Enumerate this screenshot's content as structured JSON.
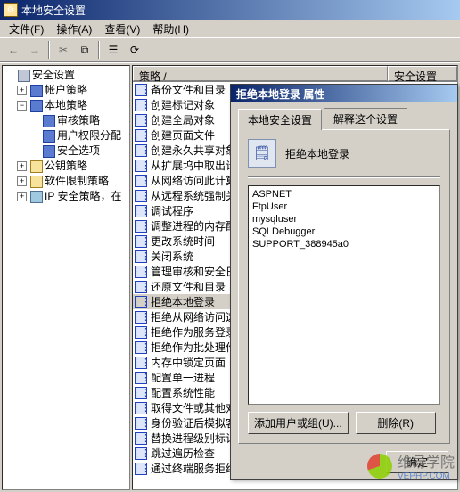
{
  "window": {
    "title": "本地安全设置"
  },
  "menu": {
    "file": "文件(F)",
    "action": "操作(A)",
    "view": "查看(V)",
    "help": "帮助(H)"
  },
  "tree": {
    "root": "安全设置",
    "account_policy": "帐户策略",
    "local_policy": "本地策略",
    "audit_policy": "审核策略",
    "user_rights": "用户权限分配",
    "security_options": "安全选项",
    "public_key": "公钥策略",
    "software_restrict": "软件限制策略",
    "ip_security": "IP 安全策略，在"
  },
  "list": {
    "col_policy": "策略  /",
    "col_security_setting": "安全设置",
    "items": [
      "备份文件和目录",
      "创建标记对象",
      "创建全局对象",
      "创建页面文件",
      "创建永久共享对象",
      "从扩展坞中取出计算机",
      "从网络访问此计算机",
      "从远程系统强制关机",
      "调试程序",
      "调整进程的内存配额",
      "更改系统时间",
      "关闭系统",
      "管理审核和安全日志",
      "还原文件和目录",
      "拒绝本地登录",
      "拒绝从网络访问这台计算机",
      "拒绝作为服务登录",
      "拒绝作为批处理作业登录",
      "内存中锁定页面",
      "配置单一进程",
      "配置系统性能",
      "取得文件或其他对象的所有权",
      "身份验证后模拟客户端",
      "替换进程级别标记",
      "跳过遍历检查",
      "通过终端服务拒绝登录"
    ],
    "selected_index": 14
  },
  "dialog": {
    "title": "拒绝本地登录 属性",
    "tab_local": "本地安全设置",
    "tab_explain": "解释这个设置",
    "policy_name": "拒绝本地登录",
    "users": [
      "ASPNET",
      "FtpUser",
      "mysqluser",
      "SQLDebugger",
      "SUPPORT_388945a0"
    ],
    "btn_add": "添加用户或组(U)...",
    "btn_remove": "删除(R)",
    "btn_ok": "确定"
  },
  "watermark": {
    "name": "维易学院",
    "url": "VEPHP.COM"
  }
}
